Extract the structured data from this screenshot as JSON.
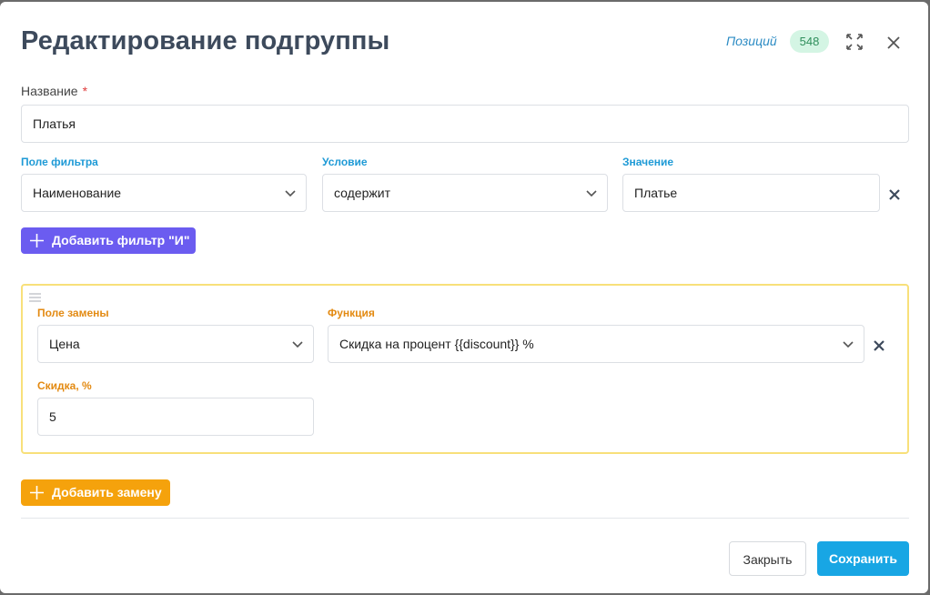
{
  "modal": {
    "title": "Редактирование подгруппы",
    "positions_label": "Позиций",
    "positions_count": "548"
  },
  "name_field": {
    "label": "Название",
    "required_mark": "*",
    "value": "Платья"
  },
  "filter": {
    "field_label": "Поле фильтра",
    "field_value": "Наименование",
    "condition_label": "Условие",
    "condition_value": "содержит",
    "value_label": "Значение",
    "value_value": "Платье",
    "add_button": "Добавить фильтр \"И\""
  },
  "replacement": {
    "field_label": "Поле замены",
    "field_value": "Цена",
    "function_label": "Функция",
    "function_value": "Скидка на процент {{discount}} %",
    "discount_label": "Скидка, %",
    "discount_value": "5",
    "add_button": "Добавить замену"
  },
  "footer": {
    "close_button": "Закрыть",
    "save_button": "Сохранить"
  },
  "colors": {
    "filter_label": "#1e9ad6",
    "replacement_label": "#e38a12",
    "add_filter_button": "#6b5cf0",
    "add_replacement_button": "#f5a20c",
    "save_button": "#18a6e4",
    "badge_bg": "#d4f5e4",
    "replacement_border": "#f8e07a"
  },
  "icons": {
    "expand": "expand-arrows-icon",
    "close": "close-icon",
    "chevron": "chevron-down-icon",
    "remove": "remove-x-icon",
    "plus": "plus-icon",
    "drag": "drag-handle-icon"
  }
}
